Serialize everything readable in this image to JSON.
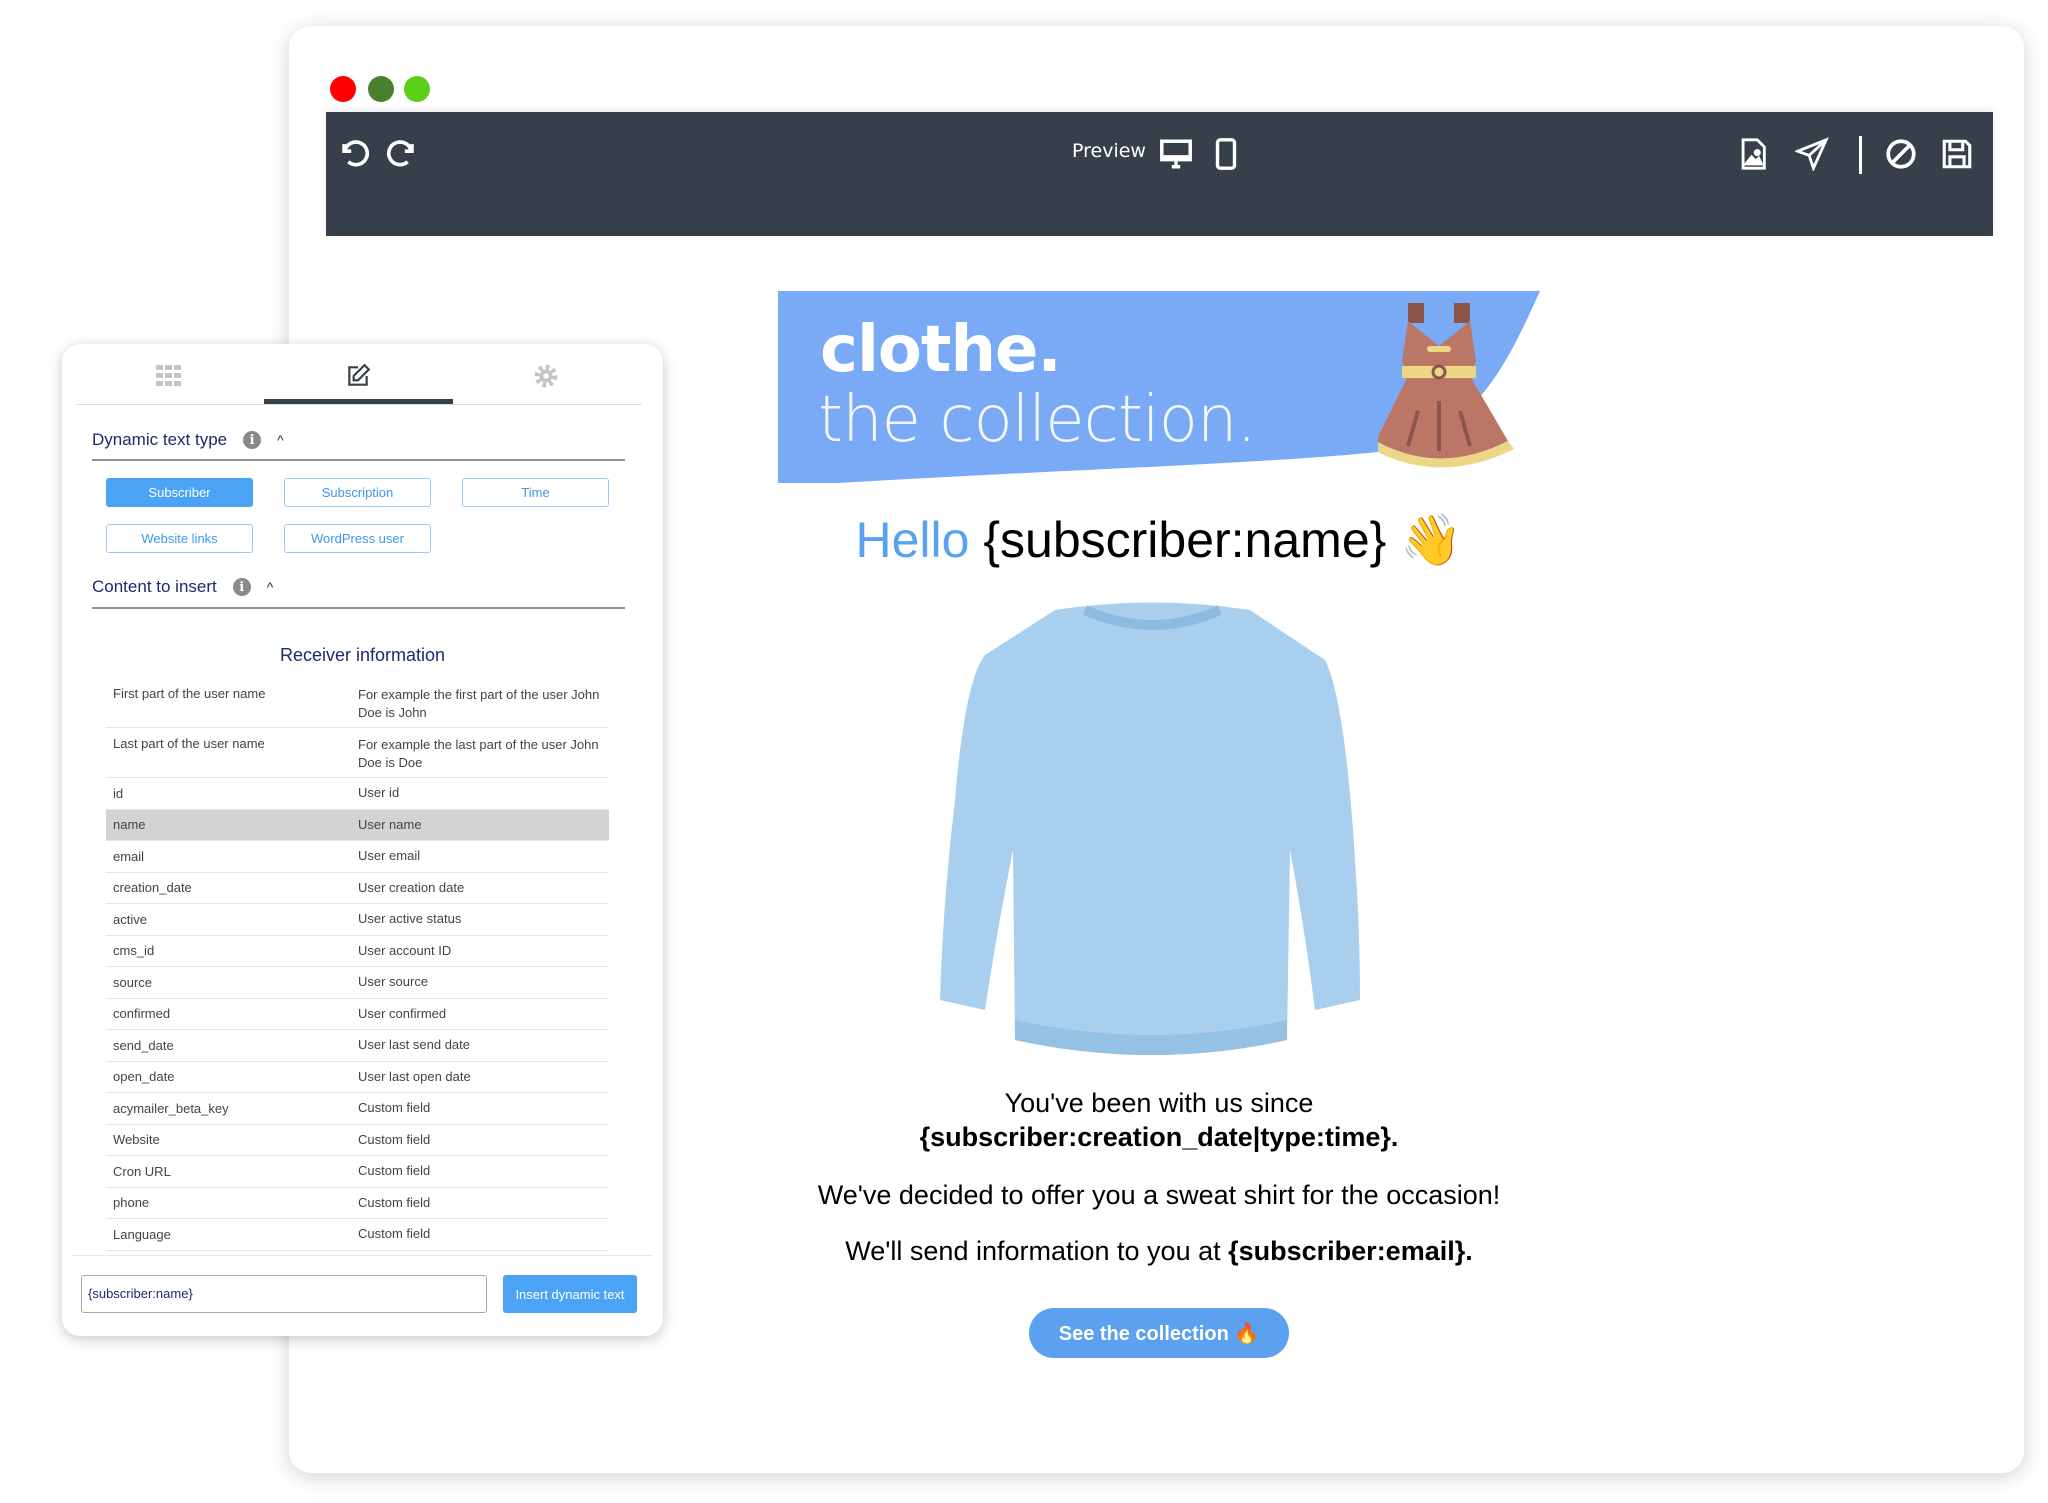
{
  "window": {
    "controls": {
      "close_color": "#ff0000",
      "minimize_color": "#4a7f2c",
      "maximize_color": "#5ccf1a"
    }
  },
  "toolbar": {
    "preview_label": "Preview",
    "icons": [
      "undo-icon",
      "redo-icon",
      "desktop-icon",
      "mobile-icon",
      "image-file-icon",
      "send-icon",
      "cancel-icon",
      "save-icon"
    ]
  },
  "email": {
    "banner": {
      "title": "clothe.",
      "subtitle": "the collection."
    },
    "greeting": {
      "hello": "Hello",
      "name_tag": "{subscriber:name}",
      "emoji": "👋"
    },
    "since_line": "You've been with us since",
    "since_tag": "{subscriber:creation_date|type:time}.",
    "offer_line": "We've decided to offer you a sweat shirt for the occasion!",
    "send_line": "We'll send information to you at",
    "send_tag": "{subscriber:email}.",
    "cta": "See the collection 🔥",
    "accent": "#5ba1ef"
  },
  "panel": {
    "tabs": [
      "blocks-icon",
      "edit-icon",
      "settings-icon"
    ],
    "dynamic_type_label": "Dynamic text type",
    "types": [
      "Subscriber",
      "Subscription",
      "Time",
      "Website links",
      "WordPress user"
    ],
    "active_type": "Subscriber",
    "content_label": "Content to insert",
    "receiver_title": "Receiver information",
    "rows": [
      {
        "key": "First part of the user name",
        "desc": "For example the first part of the user John Doe is John"
      },
      {
        "key": "Last part of the user name",
        "desc": "For example the last part of the user John Doe is Doe"
      },
      {
        "key": "id",
        "desc": "User id"
      },
      {
        "key": "name",
        "desc": "User name"
      },
      {
        "key": "email",
        "desc": "User email"
      },
      {
        "key": "creation_date",
        "desc": "User creation date"
      },
      {
        "key": "active",
        "desc": "User active status"
      },
      {
        "key": "cms_id",
        "desc": "User account ID"
      },
      {
        "key": "source",
        "desc": "User source"
      },
      {
        "key": "confirmed",
        "desc": "User confirmed"
      },
      {
        "key": "send_date",
        "desc": "User last send date"
      },
      {
        "key": "open_date",
        "desc": "User last open date"
      },
      {
        "key": "acymailer_beta_key",
        "desc": "Custom field"
      },
      {
        "key": "Website",
        "desc": "Custom field"
      },
      {
        "key": "Cron URL",
        "desc": "Custom field"
      },
      {
        "key": "phone",
        "desc": "Custom field"
      },
      {
        "key": "Language",
        "desc": "Custom field"
      }
    ],
    "selected_row": "name",
    "input_value": "{subscriber:name}",
    "insert_label": "Insert dynamic text"
  }
}
